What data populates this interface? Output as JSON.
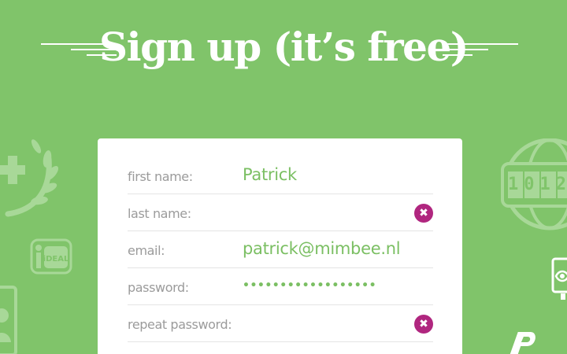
{
  "header": {
    "title": "Sign up (it’s free)"
  },
  "form": {
    "fields": [
      {
        "label": "first name:",
        "value": "Patrick"
      },
      {
        "label": "last name:",
        "value": ""
      },
      {
        "label": "email:",
        "value": "patrick@mimbee.nl"
      },
      {
        "label": "password:",
        "value": "••••••••••••••••••"
      },
      {
        "label": "repeat password:",
        "value": ""
      }
    ],
    "clear_glyph": "✖"
  },
  "decor": {
    "counter_digits": "1012",
    "ideal_text": "iDEAL"
  },
  "colors": {
    "background": "#80c46a",
    "accent_text": "#7bbf63",
    "clear_button": "#b0267f",
    "card": "#ffffff"
  }
}
